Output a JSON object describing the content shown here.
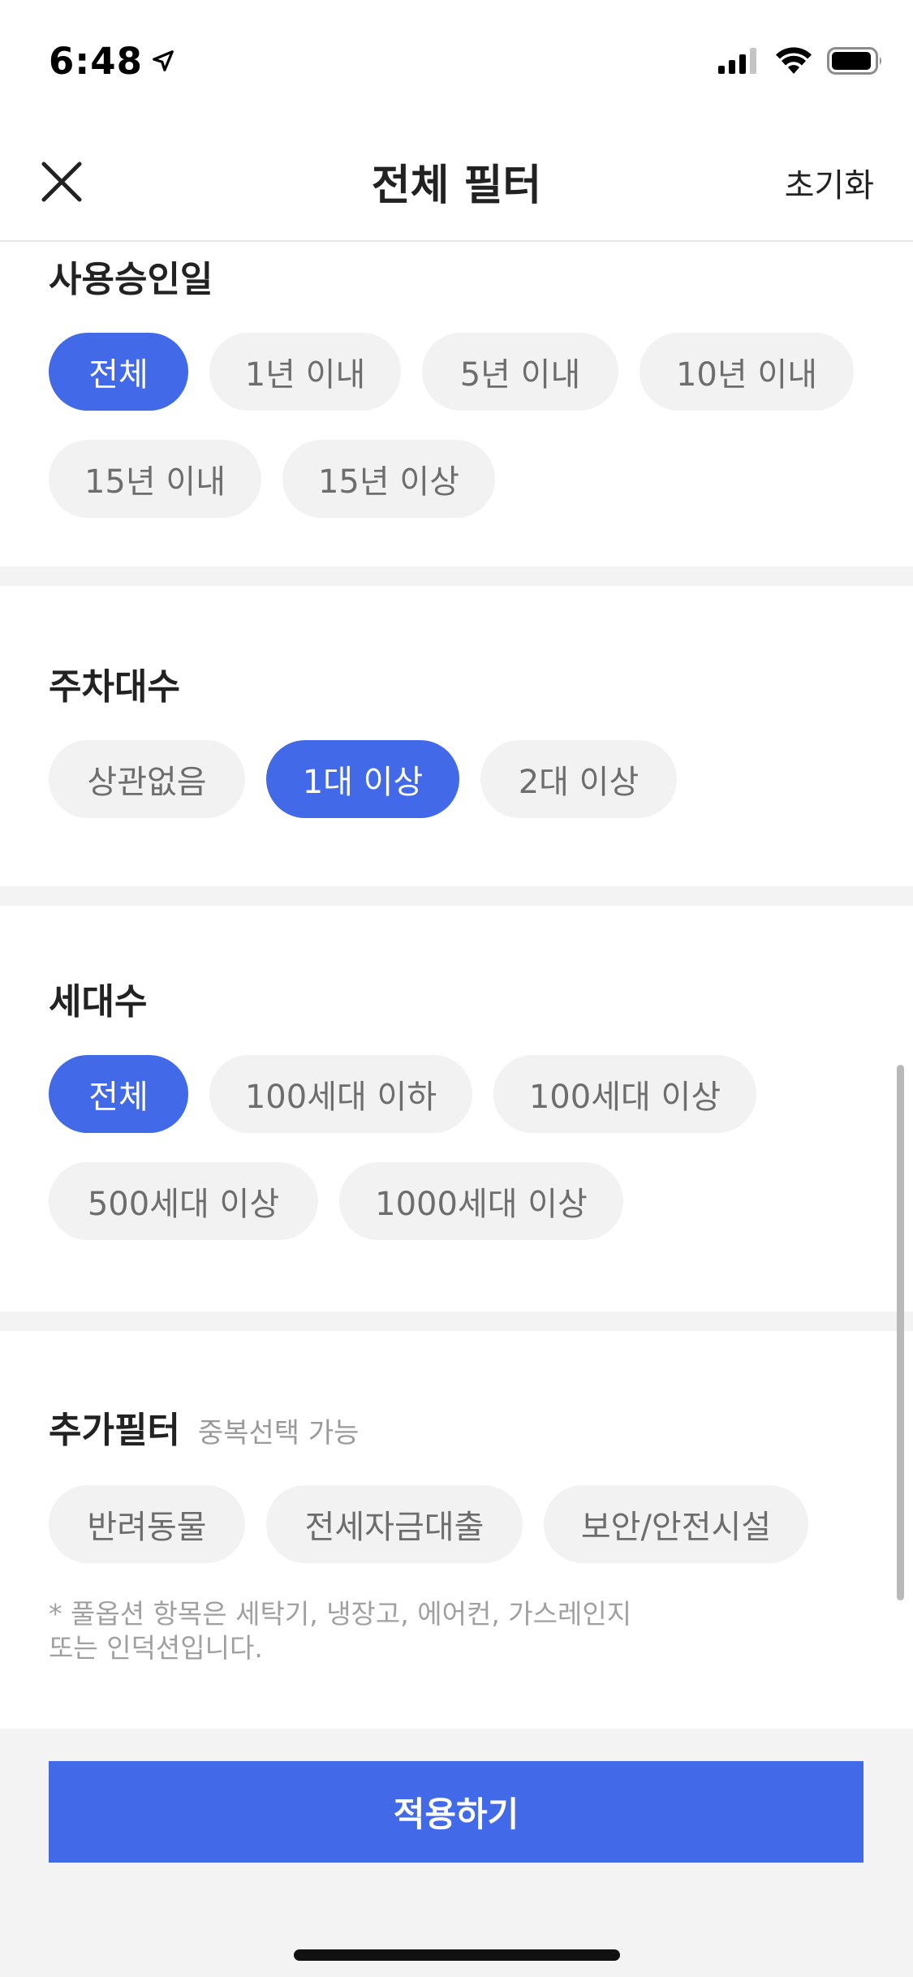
{
  "status_bar": {
    "time": "6:48"
  },
  "nav": {
    "title": "전체 필터",
    "reset_label": "초기화"
  },
  "sections": {
    "approval_date": {
      "title": "사용승인일",
      "options": [
        "전체",
        "1년 이내",
        "5년 이내",
        "10년 이내",
        "15년 이내",
        "15년 이상"
      ],
      "selected": "전체"
    },
    "parking": {
      "title": "주차대수",
      "options": [
        "상관없음",
        "1대 이상",
        "2대 이상"
      ],
      "selected": "1대 이상"
    },
    "households": {
      "title": "세대수",
      "options": [
        "전체",
        "100세대 이하",
        "100세대 이상",
        "500세대 이상",
        "1000세대 이상"
      ],
      "selected": "전체"
    },
    "extra": {
      "title": "추가필터",
      "subtitle": "중복선택 가능",
      "options": [
        "반려동물",
        "전세자금대출",
        "보안/안전시설"
      ],
      "note_line1": "* 풀옵션 항목은 세탁기, 냉장고, 에어컨, 가스레인지",
      "note_line2": "또는 인덕션입니다."
    }
  },
  "footer": {
    "apply_label": "적용하기"
  },
  "colors": {
    "accent": "#4169e8",
    "chip_bg": "#f2f2f2",
    "chip_text": "#6d6d6d",
    "divider": "#f3f3f3"
  }
}
